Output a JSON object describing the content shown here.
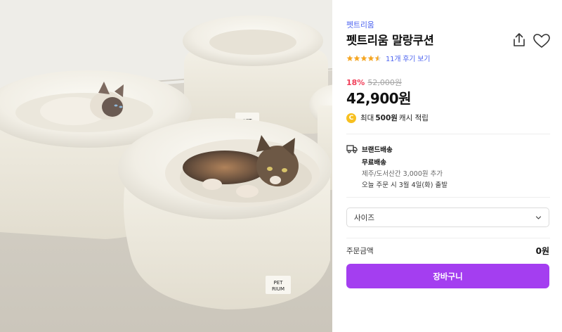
{
  "product": {
    "brand": "펫트리움",
    "title": "펫트리움 말랑쿠션",
    "rating": 4.5,
    "review_link": "11개 후기 보기",
    "discount": "18%",
    "original_price": "52,000원",
    "price": "42,900원"
  },
  "cash": {
    "prefix": "최대",
    "amount": "500원",
    "suffix": "캐시 적립",
    "coin_label": "C"
  },
  "shipping": {
    "title": "브랜드배송",
    "free": "무료배송",
    "extra": "제주/도서산간 3,000원 추가",
    "date": "오늘 주문 시 3월 4일(화) 출발"
  },
  "option": {
    "size_label": "사이즈"
  },
  "order": {
    "total_label": "주문금액",
    "total_value": "0원",
    "cart_button": "장바구니"
  },
  "image": {
    "bed_tag_small": "PET",
    "bed_tag_large_1": "PET",
    "bed_tag_large_2": "RIUM"
  },
  "colors": {
    "brand_link": "#4f66f0",
    "discount": "#f0405a",
    "cart_button": "#a43ef0",
    "star": "#f5a623",
    "coin": "#f7c020"
  },
  "icons": [
    "share-icon",
    "heart-icon",
    "star-icon",
    "coin-icon",
    "truck-icon",
    "chevron-down-icon"
  ]
}
